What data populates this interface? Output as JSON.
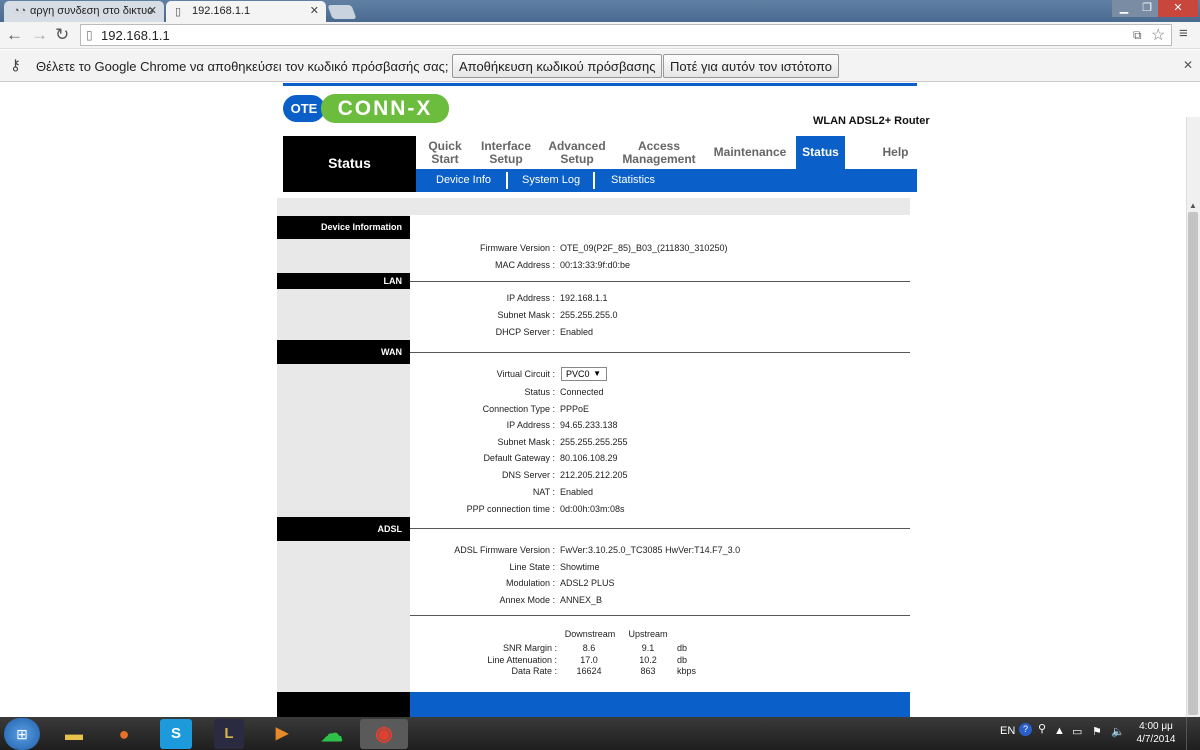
{
  "browser": {
    "tabs": [
      {
        "title": "αργη συνδεση στο δικτυο"
      },
      {
        "title": "192.168.1.1"
      }
    ],
    "url": "192.168.1.1",
    "password_bar": {
      "message": "Θέλετε το Google Chrome να αποθηκεύσει τον κωδικό πρόσβασής σας;",
      "save_label": "Αποθήκευση κωδικού πρόσβασης",
      "never_label": "Ποτέ για αυτόν τον ιστότοπο"
    }
  },
  "router": {
    "logo_left": "OTE",
    "logo_right": "CONN-X",
    "model": "WLAN ADSL2+ Router",
    "page_title": "Status",
    "main_nav": [
      {
        "line1": "Quick",
        "line2": "Start"
      },
      {
        "line1": "Interface",
        "line2": "Setup"
      },
      {
        "line1": "Advanced",
        "line2": "Setup"
      },
      {
        "line1": "Access",
        "line2": "Management"
      },
      {
        "line1": "Maintenance",
        "line2": ""
      },
      {
        "line1": "Status",
        "line2": ""
      },
      {
        "line1": "Help",
        "line2": ""
      }
    ],
    "sub_nav": [
      "Device Info",
      "System Log",
      "Statistics"
    ],
    "sections": {
      "device": "Device Information",
      "lan": "LAN",
      "wan": "WAN",
      "adsl": "ADSL"
    },
    "device": {
      "firmware_label": "Firmware Version",
      "firmware": "OTE_09(P2F_85)_B03_(211830_310250)",
      "mac_label": "MAC Address",
      "mac": "00:13:33:9f:d0:be"
    },
    "lan": {
      "ip_label": "IP Address",
      "ip": "192.168.1.1",
      "mask_label": "Subnet Mask",
      "mask": "255.255.255.0",
      "dhcp_label": "DHCP Server",
      "dhcp": "Enabled"
    },
    "wan": {
      "vc_label": "Virtual Circuit",
      "vc": "PVC0",
      "status_label": "Status",
      "status": "Connected",
      "conn_label": "Connection Type",
      "conn": "PPPoE",
      "ip_label": "IP Address",
      "ip": "94.65.233.138",
      "mask_label": "Subnet Mask",
      "mask": "255.255.255.255",
      "gw_label": "Default Gateway",
      "gw": "80.106.108.29",
      "dns_label": "DNS Server",
      "dns": "212.205.212.205",
      "nat_label": "NAT",
      "nat": "Enabled",
      "ppp_label": "PPP connection time",
      "ppp": "0d:00h:03m:08s"
    },
    "adsl": {
      "fw_label": "ADSL Firmware Version",
      "fw": "FwVer:3.10.25.0_TC3085 HwVer:T14.F7_3.0",
      "state_label": "Line State",
      "state": "Showtime",
      "mod_label": "Modulation",
      "mod": "ADSL2 PLUS",
      "annex_label": "Annex Mode",
      "annex": "ANNEX_B"
    },
    "stats": {
      "col_down": "Downstream",
      "col_up": "Upstream",
      "rows": [
        {
          "label": "SNR Margin",
          "down": "8.6",
          "up": "9.1",
          "unit": "db"
        },
        {
          "label": "Line Attenuation",
          "down": "17.0",
          "up": "10.2",
          "unit": "db"
        },
        {
          "label": "Data Rate",
          "down": "16624",
          "up": "863",
          "unit": "kbps"
        }
      ]
    }
  },
  "taskbar": {
    "lang": "EN",
    "time": "4:00 μμ",
    "date": "4/7/2014"
  }
}
